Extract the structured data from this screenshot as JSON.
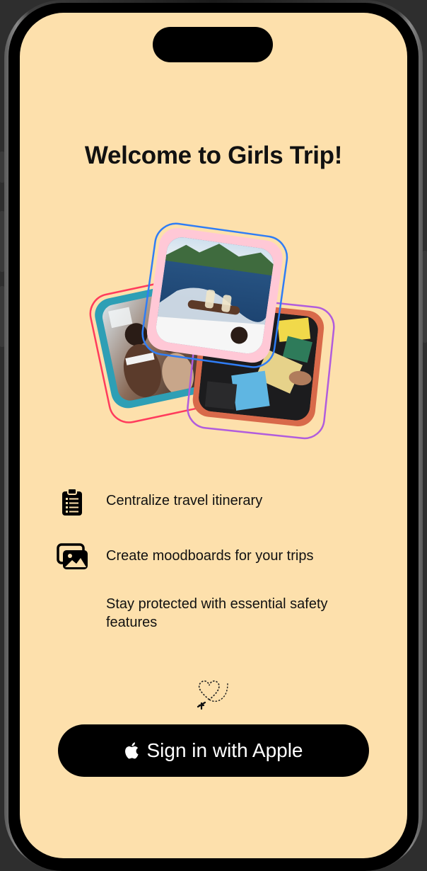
{
  "welcome": {
    "title": "Welcome to Girls Trip!"
  },
  "collage": {
    "photos": [
      {
        "name": "beach-group-photo",
        "frame_color": "#ff3b5c",
        "mat_color": "#2e9fb5"
      },
      {
        "name": "passports-photo",
        "frame_color": "#b15cdd",
        "mat_color": "#d8694a"
      },
      {
        "name": "boat-toast-photo",
        "frame_color": "#2f7df6",
        "mat_color": "#ffc8d6"
      }
    ]
  },
  "features": [
    {
      "icon": "clipboard-list-icon",
      "text": "Centralize travel itinerary"
    },
    {
      "icon": "photo-stack-icon",
      "text": "Create moodboards for your trips"
    },
    {
      "icon": "",
      "text": "Stay protected with essential safety features"
    }
  ],
  "decoration": {
    "icon": "heart-airplane-doodle-icon"
  },
  "signin": {
    "label": "Sign in with Apple",
    "icon": "apple-logo-icon"
  },
  "colors": {
    "background": "#fde0ac",
    "button": "#000000",
    "button_text": "#ffffff"
  }
}
